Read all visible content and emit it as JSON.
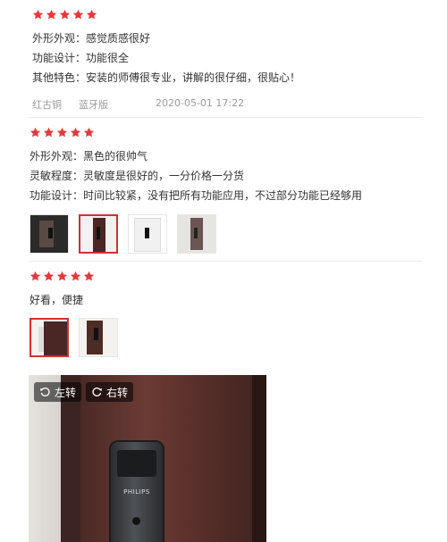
{
  "reviews": [
    {
      "rating": 5,
      "lines": [
        "外形外观：感觉质感很好",
        "功能设计：功能很全",
        "其他特色：安装的师傅很专业，讲解的很仔细，很贴心！"
      ],
      "meta": {
        "color": "红古铜",
        "version": "蓝牙版",
        "date": "2020-05-01 17:22"
      }
    },
    {
      "rating": 5,
      "lines": [
        "外形外观：黑色的很帅气",
        "灵敏程度：灵敏度是很好的，一分价格一分货",
        "功能设计：时间比较紧，没有把所有功能应用，不过部分功能已经够用"
      ],
      "photo_count": 4
    },
    {
      "rating": 5,
      "lines": [
        "好看，便捷"
      ],
      "photo_count": 2
    }
  ],
  "viewer": {
    "rotate_left_label": "左转",
    "rotate_right_label": "右转",
    "brand_text": "PHILIPS"
  },
  "colors": {
    "star": "#e4393c",
    "selected_border": "#cc3333"
  }
}
